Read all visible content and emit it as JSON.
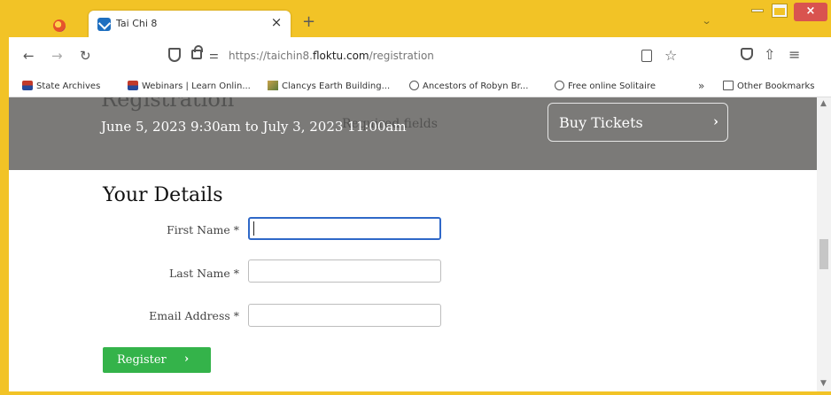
{
  "browser": {
    "tab": {
      "title": "Tai Chi 8",
      "close": "×"
    },
    "new_tab": "+",
    "tabs_menu": "⌄",
    "window": {
      "close": "×"
    },
    "nav": {
      "back": "←",
      "forward": "→",
      "reload": "↻",
      "star": "☆",
      "extensions": "⇧",
      "menu": "≡"
    },
    "url": {
      "prefix": "https://taichin8.",
      "domain": "floktu.com",
      "path": "/registration"
    },
    "bookmarks": [
      {
        "label": "State Archives",
        "icon": "nsw-icon"
      },
      {
        "label": "Webinars | Learn Onlin...",
        "icon": "nsw-icon"
      },
      {
        "label": "Clancys Earth Building...",
        "icon": "clancys-icon"
      },
      {
        "label": "Ancestors of Robyn Br...",
        "icon": "globe-icon"
      },
      {
        "label": "Free online Solitaire",
        "icon": "globe-icon"
      }
    ],
    "bookmarks_overflow": "»",
    "other_bookmarks": "Other Bookmarks"
  },
  "page": {
    "banner": {
      "ghost_heading": "Registration",
      "ghost_note": "Required fields",
      "event_dates": "June 5, 2023 9:30am to July 3, 2023 11:00am",
      "buy_tickets": "Buy Tickets",
      "buy_chevron": "›"
    },
    "form": {
      "heading": "Your Details",
      "first_name_label": "First Name *",
      "first_name_value": "",
      "last_name_label": "Last Name *",
      "last_name_value": "",
      "email_label": "Email Address *",
      "email_value": "",
      "register_label": "Register",
      "register_chevron": "›"
    }
  },
  "colors": {
    "browser_frame": "#f2c326",
    "banner_bg": "#7b7a78",
    "register_green": "#34b34a",
    "focus_blue": "#2f68c8",
    "window_close_red": "#d9534f"
  }
}
